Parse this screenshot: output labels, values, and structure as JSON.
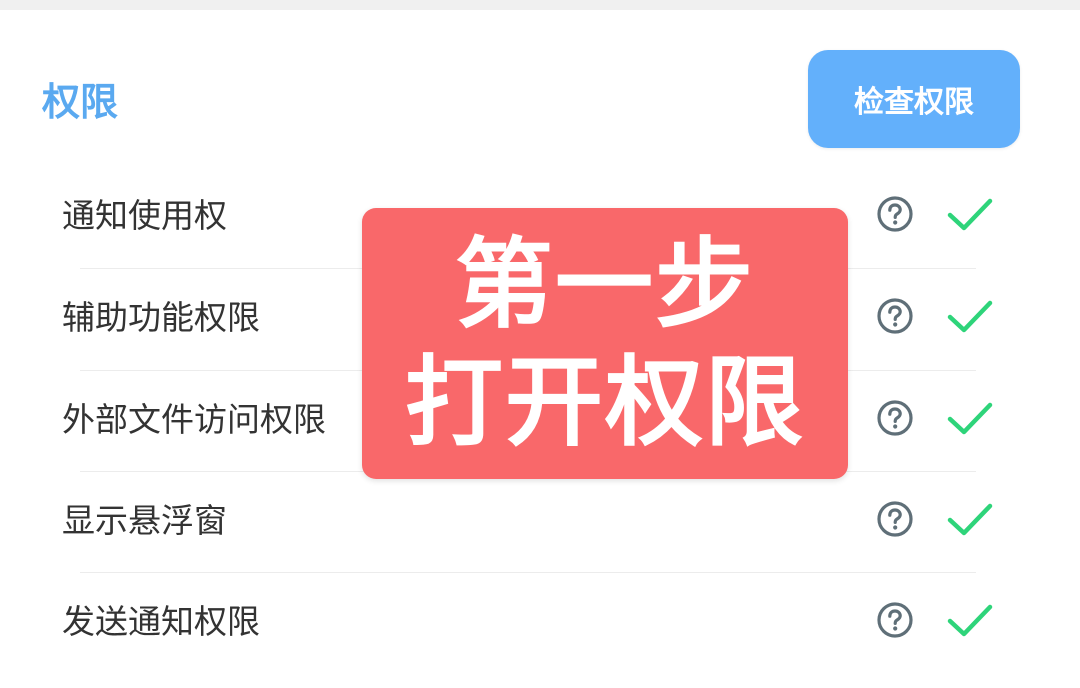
{
  "section": {
    "title": "权限",
    "check_button_label": "检查权限"
  },
  "permissions": [
    {
      "label": "通知使用权",
      "help_icon": "help-circle-icon",
      "status_icon": "checkmark-icon",
      "granted": true
    },
    {
      "label": "辅助功能权限",
      "help_icon": "help-circle-icon",
      "status_icon": "checkmark-icon",
      "granted": true
    },
    {
      "label": "外部文件访问权限",
      "help_icon": "help-circle-icon",
      "status_icon": "checkmark-icon",
      "granted": true
    },
    {
      "label": "显示悬浮窗",
      "help_icon": "help-circle-icon",
      "status_icon": "checkmark-icon",
      "granted": true
    },
    {
      "label": "发送通知权限",
      "help_icon": "help-circle-icon",
      "status_icon": "checkmark-icon",
      "granted": true
    }
  ],
  "overlay": {
    "line1": "第一步",
    "line2": "打开权限"
  },
  "colors": {
    "title": "#5aa9f0",
    "button_bg": "#63b0fb",
    "check": "#2ed47a",
    "help_icon": "#5f6f78",
    "overlay_bg": "#f9686a"
  }
}
